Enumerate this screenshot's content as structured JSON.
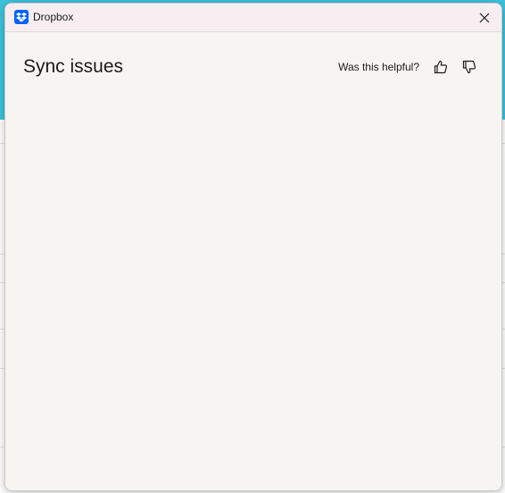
{
  "window": {
    "app_name": "Dropbox",
    "title": "Sync issues"
  },
  "feedback": {
    "prompt": "Was this helpful?"
  },
  "icons": {
    "app": "dropbox-logo-icon",
    "close": "close-icon",
    "thumbs_up": "thumbs-up-icon",
    "thumbs_down": "thumbs-down-icon"
  },
  "colors": {
    "brand": "#0061fe",
    "background_header": "#3cc3dc",
    "dialog_bg": "#f7f5f2",
    "titlebar_bg": "#f8eef2"
  }
}
